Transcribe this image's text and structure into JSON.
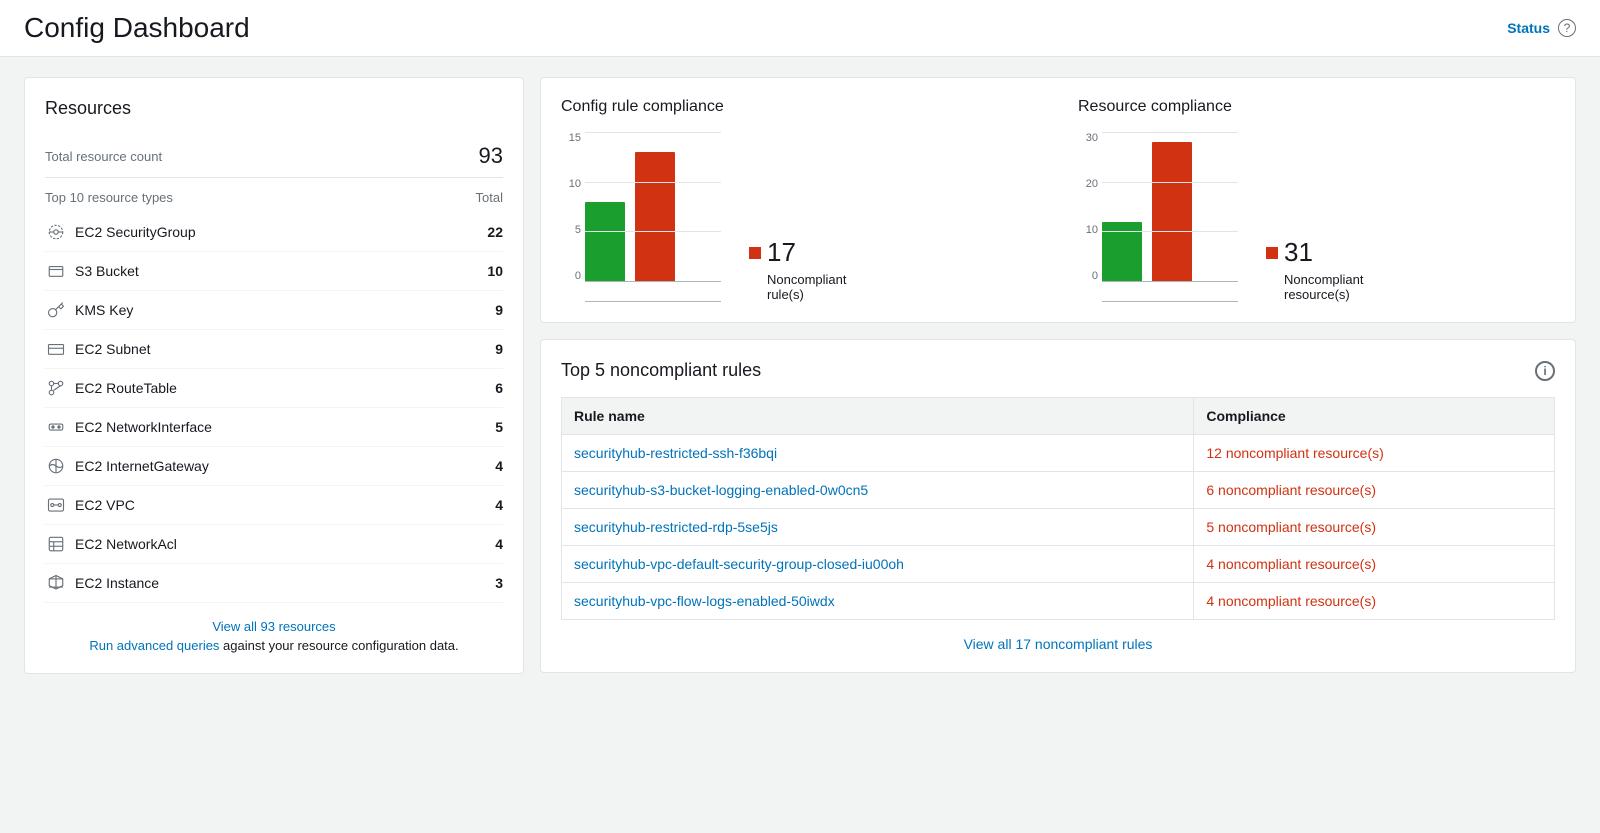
{
  "header": {
    "title": "Config Dashboard",
    "status_label": "Status",
    "help_icon": "?"
  },
  "resources_panel": {
    "title": "Resources",
    "total_label": "Total resource count",
    "total_value": "93",
    "top_label": "Top 10 resource types",
    "top_total_label": "Total",
    "resources": [
      {
        "icon": "ec2-sg",
        "name": "EC2 SecurityGroup",
        "count": "22"
      },
      {
        "icon": "s3",
        "name": "S3 Bucket",
        "count": "10"
      },
      {
        "icon": "kms",
        "name": "KMS Key",
        "count": "9"
      },
      {
        "icon": "ec2-subnet",
        "name": "EC2 Subnet",
        "count": "9"
      },
      {
        "icon": "ec2-rt",
        "name": "EC2 RouteTable",
        "count": "6"
      },
      {
        "icon": "ec2-ni",
        "name": "EC2 NetworkInterface",
        "count": "5"
      },
      {
        "icon": "ec2-igw",
        "name": "EC2 InternetGateway",
        "count": "4"
      },
      {
        "icon": "ec2-vpc",
        "name": "EC2 VPC",
        "count": "4"
      },
      {
        "icon": "ec2-acl",
        "name": "EC2 NetworkAcl",
        "count": "4"
      },
      {
        "icon": "ec2-instance",
        "name": "EC2 Instance",
        "count": "3"
      }
    ],
    "view_all_text": "View all 93 resources",
    "footer_text": "Run advanced queries",
    "footer_rest": " against your resource configuration data."
  },
  "config_rule_chart": {
    "title": "Config rule compliance",
    "y_axis": [
      "15",
      "10",
      "5",
      "0"
    ],
    "compliant_height": 80,
    "noncompliant_height": 130,
    "stat_value": "17",
    "stat_label": "Noncompliant\nrule(s)"
  },
  "resource_compliance_chart": {
    "title": "Resource compliance",
    "y_axis": [
      "30",
      "20",
      "10",
      "0"
    ],
    "compliant_height": 60,
    "noncompliant_height": 140,
    "stat_value": "31",
    "stat_label": "Noncompliant\nresource(s)"
  },
  "rules_panel": {
    "title": "Top 5 noncompliant rules",
    "col_rule": "Rule name",
    "col_compliance": "Compliance",
    "rules": [
      {
        "name": "securityhub-restricted-ssh-f36bqi",
        "compliance": "12 noncompliant resource(s)"
      },
      {
        "name": "securityhub-s3-bucket-logging-enabled-0w0cn5",
        "compliance": "6 noncompliant resource(s)"
      },
      {
        "name": "securityhub-restricted-rdp-5se5js",
        "compliance": "5 noncompliant resource(s)"
      },
      {
        "name": "securityhub-vpc-default-security-group-closed-iu00oh",
        "compliance": "4 noncompliant resource(s)"
      },
      {
        "name": "securityhub-vpc-flow-logs-enabled-50iwdx",
        "compliance": "4 noncompliant resource(s)"
      }
    ],
    "view_all_link": "View all 17 noncompliant rules"
  }
}
